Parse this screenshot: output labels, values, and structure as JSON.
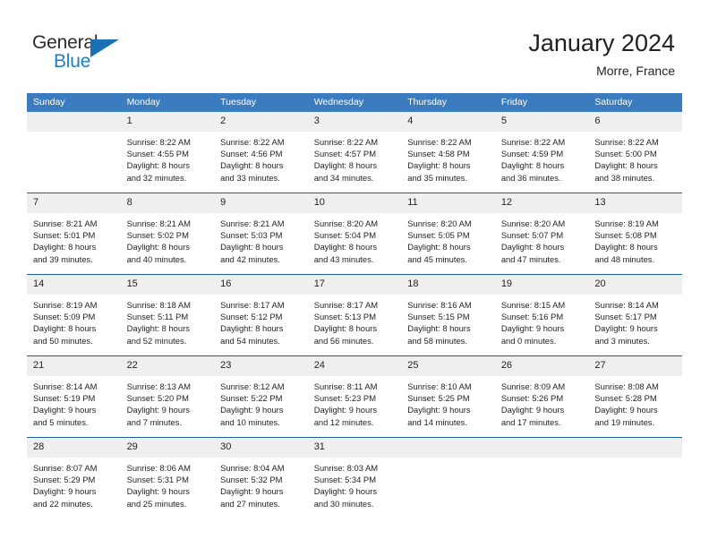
{
  "logo": {
    "word_top": "General",
    "word_bottom": "Blue",
    "flag_icon": "triangle-flag-icon",
    "top_color": "#2b2b2b",
    "bottom_color": "#1f7ec4"
  },
  "header": {
    "title": "January 2024",
    "subtitle": "Morre, France"
  },
  "theme": {
    "header_blue": "#3a7cbe",
    "row_divider_blue": "#1d5f9e",
    "daynum_band": "#efefef",
    "text": "#231f20"
  },
  "calendar": {
    "weekday_headers": [
      "Sunday",
      "Monday",
      "Tuesday",
      "Wednesday",
      "Thursday",
      "Friday",
      "Saturday"
    ],
    "weeks": [
      [
        {
          "day": "",
          "empty": true,
          "sunrise": "",
          "sunset": "",
          "daylight_line1": "",
          "daylight_line2": ""
        },
        {
          "day": "1",
          "empty": false,
          "sunrise": "Sunrise: 8:22 AM",
          "sunset": "Sunset: 4:55 PM",
          "daylight_line1": "Daylight: 8 hours",
          "daylight_line2": "and 32 minutes."
        },
        {
          "day": "2",
          "empty": false,
          "sunrise": "Sunrise: 8:22 AM",
          "sunset": "Sunset: 4:56 PM",
          "daylight_line1": "Daylight: 8 hours",
          "daylight_line2": "and 33 minutes."
        },
        {
          "day": "3",
          "empty": false,
          "sunrise": "Sunrise: 8:22 AM",
          "sunset": "Sunset: 4:57 PM",
          "daylight_line1": "Daylight: 8 hours",
          "daylight_line2": "and 34 minutes."
        },
        {
          "day": "4",
          "empty": false,
          "sunrise": "Sunrise: 8:22 AM",
          "sunset": "Sunset: 4:58 PM",
          "daylight_line1": "Daylight: 8 hours",
          "daylight_line2": "and 35 minutes."
        },
        {
          "day": "5",
          "empty": false,
          "sunrise": "Sunrise: 8:22 AM",
          "sunset": "Sunset: 4:59 PM",
          "daylight_line1": "Daylight: 8 hours",
          "daylight_line2": "and 36 minutes."
        },
        {
          "day": "6",
          "empty": false,
          "sunrise": "Sunrise: 8:22 AM",
          "sunset": "Sunset: 5:00 PM",
          "daylight_line1": "Daylight: 8 hours",
          "daylight_line2": "and 38 minutes."
        }
      ],
      [
        {
          "day": "7",
          "empty": false,
          "sunrise": "Sunrise: 8:21 AM",
          "sunset": "Sunset: 5:01 PM",
          "daylight_line1": "Daylight: 8 hours",
          "daylight_line2": "and 39 minutes."
        },
        {
          "day": "8",
          "empty": false,
          "sunrise": "Sunrise: 8:21 AM",
          "sunset": "Sunset: 5:02 PM",
          "daylight_line1": "Daylight: 8 hours",
          "daylight_line2": "and 40 minutes."
        },
        {
          "day": "9",
          "empty": false,
          "sunrise": "Sunrise: 8:21 AM",
          "sunset": "Sunset: 5:03 PM",
          "daylight_line1": "Daylight: 8 hours",
          "daylight_line2": "and 42 minutes."
        },
        {
          "day": "10",
          "empty": false,
          "sunrise": "Sunrise: 8:20 AM",
          "sunset": "Sunset: 5:04 PM",
          "daylight_line1": "Daylight: 8 hours",
          "daylight_line2": "and 43 minutes."
        },
        {
          "day": "11",
          "empty": false,
          "sunrise": "Sunrise: 8:20 AM",
          "sunset": "Sunset: 5:05 PM",
          "daylight_line1": "Daylight: 8 hours",
          "daylight_line2": "and 45 minutes."
        },
        {
          "day": "12",
          "empty": false,
          "sunrise": "Sunrise: 8:20 AM",
          "sunset": "Sunset: 5:07 PM",
          "daylight_line1": "Daylight: 8 hours",
          "daylight_line2": "and 47 minutes."
        },
        {
          "day": "13",
          "empty": false,
          "sunrise": "Sunrise: 8:19 AM",
          "sunset": "Sunset: 5:08 PM",
          "daylight_line1": "Daylight: 8 hours",
          "daylight_line2": "and 48 minutes."
        }
      ],
      [
        {
          "day": "14",
          "empty": false,
          "sunrise": "Sunrise: 8:19 AM",
          "sunset": "Sunset: 5:09 PM",
          "daylight_line1": "Daylight: 8 hours",
          "daylight_line2": "and 50 minutes."
        },
        {
          "day": "15",
          "empty": false,
          "sunrise": "Sunrise: 8:18 AM",
          "sunset": "Sunset: 5:11 PM",
          "daylight_line1": "Daylight: 8 hours",
          "daylight_line2": "and 52 minutes."
        },
        {
          "day": "16",
          "empty": false,
          "sunrise": "Sunrise: 8:17 AM",
          "sunset": "Sunset: 5:12 PM",
          "daylight_line1": "Daylight: 8 hours",
          "daylight_line2": "and 54 minutes."
        },
        {
          "day": "17",
          "empty": false,
          "sunrise": "Sunrise: 8:17 AM",
          "sunset": "Sunset: 5:13 PM",
          "daylight_line1": "Daylight: 8 hours",
          "daylight_line2": "and 56 minutes."
        },
        {
          "day": "18",
          "empty": false,
          "sunrise": "Sunrise: 8:16 AM",
          "sunset": "Sunset: 5:15 PM",
          "daylight_line1": "Daylight: 8 hours",
          "daylight_line2": "and 58 minutes."
        },
        {
          "day": "19",
          "empty": false,
          "sunrise": "Sunrise: 8:15 AM",
          "sunset": "Sunset: 5:16 PM",
          "daylight_line1": "Daylight: 9 hours",
          "daylight_line2": "and 0 minutes."
        },
        {
          "day": "20",
          "empty": false,
          "sunrise": "Sunrise: 8:14 AM",
          "sunset": "Sunset: 5:17 PM",
          "daylight_line1": "Daylight: 9 hours",
          "daylight_line2": "and 3 minutes."
        }
      ],
      [
        {
          "day": "21",
          "empty": false,
          "sunrise": "Sunrise: 8:14 AM",
          "sunset": "Sunset: 5:19 PM",
          "daylight_line1": "Daylight: 9 hours",
          "daylight_line2": "and 5 minutes."
        },
        {
          "day": "22",
          "empty": false,
          "sunrise": "Sunrise: 8:13 AM",
          "sunset": "Sunset: 5:20 PM",
          "daylight_line1": "Daylight: 9 hours",
          "daylight_line2": "and 7 minutes."
        },
        {
          "day": "23",
          "empty": false,
          "sunrise": "Sunrise: 8:12 AM",
          "sunset": "Sunset: 5:22 PM",
          "daylight_line1": "Daylight: 9 hours",
          "daylight_line2": "and 10 minutes."
        },
        {
          "day": "24",
          "empty": false,
          "sunrise": "Sunrise: 8:11 AM",
          "sunset": "Sunset: 5:23 PM",
          "daylight_line1": "Daylight: 9 hours",
          "daylight_line2": "and 12 minutes."
        },
        {
          "day": "25",
          "empty": false,
          "sunrise": "Sunrise: 8:10 AM",
          "sunset": "Sunset: 5:25 PM",
          "daylight_line1": "Daylight: 9 hours",
          "daylight_line2": "and 14 minutes."
        },
        {
          "day": "26",
          "empty": false,
          "sunrise": "Sunrise: 8:09 AM",
          "sunset": "Sunset: 5:26 PM",
          "daylight_line1": "Daylight: 9 hours",
          "daylight_line2": "and 17 minutes."
        },
        {
          "day": "27",
          "empty": false,
          "sunrise": "Sunrise: 8:08 AM",
          "sunset": "Sunset: 5:28 PM",
          "daylight_line1": "Daylight: 9 hours",
          "daylight_line2": "and 19 minutes."
        }
      ],
      [
        {
          "day": "28",
          "empty": false,
          "sunrise": "Sunrise: 8:07 AM",
          "sunset": "Sunset: 5:29 PM",
          "daylight_line1": "Daylight: 9 hours",
          "daylight_line2": "and 22 minutes."
        },
        {
          "day": "29",
          "empty": false,
          "sunrise": "Sunrise: 8:06 AM",
          "sunset": "Sunset: 5:31 PM",
          "daylight_line1": "Daylight: 9 hours",
          "daylight_line2": "and 25 minutes."
        },
        {
          "day": "30",
          "empty": false,
          "sunrise": "Sunrise: 8:04 AM",
          "sunset": "Sunset: 5:32 PM",
          "daylight_line1": "Daylight: 9 hours",
          "daylight_line2": "and 27 minutes."
        },
        {
          "day": "31",
          "empty": false,
          "sunrise": "Sunrise: 8:03 AM",
          "sunset": "Sunset: 5:34 PM",
          "daylight_line1": "Daylight: 9 hours",
          "daylight_line2": "and 30 minutes."
        },
        {
          "day": "",
          "empty": true,
          "sunrise": "",
          "sunset": "",
          "daylight_line1": "",
          "daylight_line2": ""
        },
        {
          "day": "",
          "empty": true,
          "sunrise": "",
          "sunset": "",
          "daylight_line1": "",
          "daylight_line2": ""
        },
        {
          "day": "",
          "empty": true,
          "sunrise": "",
          "sunset": "",
          "daylight_line1": "",
          "daylight_line2": ""
        }
      ]
    ]
  }
}
